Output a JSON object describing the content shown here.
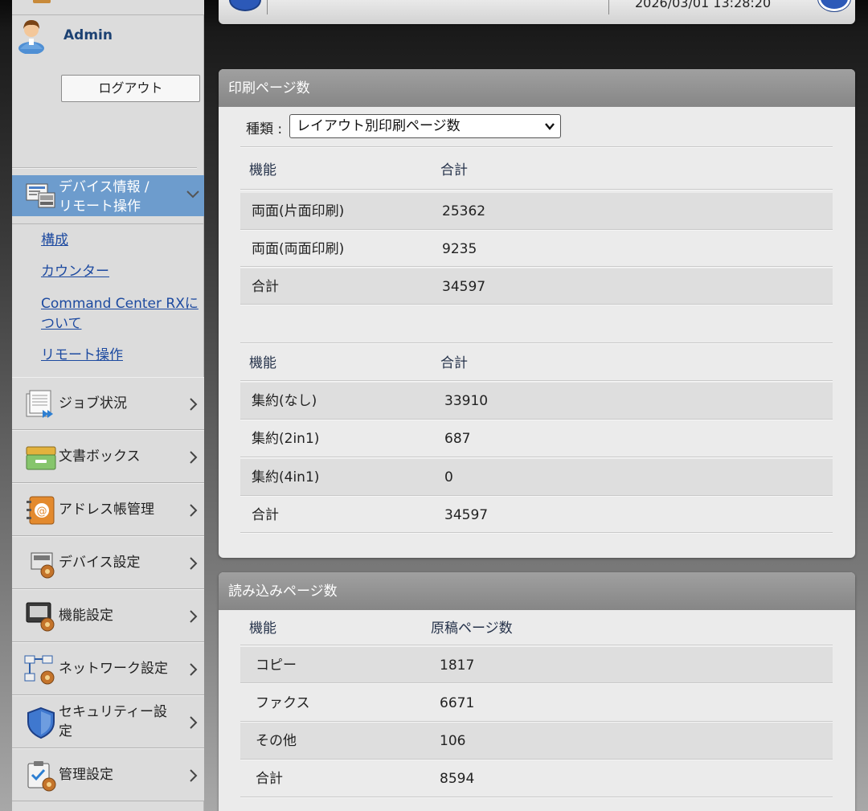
{
  "user": {
    "name": "Admin",
    "logout_label": "ログアウト"
  },
  "header": {
    "datetime": "2026/03/01 13:28:20"
  },
  "sidebar": {
    "active_section": {
      "label": "デバイス情報 /\nリモート操作"
    },
    "sub_links": [
      {
        "label": "構成"
      },
      {
        "label": "カウンター"
      },
      {
        "label": "Command Center RXに\nついて"
      },
      {
        "label": "リモート操作"
      }
    ],
    "items": [
      {
        "label": "ジョブ状況",
        "icon": "job-status-icon"
      },
      {
        "label": "文書ボックス",
        "icon": "document-box-icon"
      },
      {
        "label": "アドレス帳管理",
        "icon": "address-book-icon"
      },
      {
        "label": "デバイス設定",
        "icon": "device-settings-icon"
      },
      {
        "label": "機能設定",
        "icon": "function-settings-icon"
      },
      {
        "label": "ネットワーク設定",
        "icon": "network-settings-icon"
      },
      {
        "label": "セキュリティー設\n定",
        "icon": "security-shield-icon"
      },
      {
        "label": "管理設定",
        "icon": "management-settings-icon"
      }
    ]
  },
  "print_panel": {
    "title": "印刷ページ数",
    "type_label": "種類 :",
    "type_value": "レイアウト別印刷ページ数",
    "table1": {
      "headers": [
        "機能",
        "合計"
      ],
      "rows": [
        [
          "両面(片面印刷)",
          "25362"
        ],
        [
          "両面(両面印刷)",
          "9235"
        ],
        [
          "合計",
          "34597"
        ]
      ]
    },
    "table2": {
      "headers": [
        "機能",
        "合計"
      ],
      "rows": [
        [
          "集約(なし)",
          "33910"
        ],
        [
          "集約(2in1)",
          "687"
        ],
        [
          "集約(4in1)",
          "0"
        ],
        [
          "合計",
          "34597"
        ]
      ]
    }
  },
  "scan_panel": {
    "title": "読み込みページ数",
    "headers": [
      "機能",
      "原稿ページ数"
    ],
    "rows": [
      [
        "コピー",
        "1817"
      ],
      [
        "ファクス",
        "6671"
      ],
      [
        "その他",
        "106"
      ],
      [
        "合計",
        "8594"
      ]
    ]
  }
}
